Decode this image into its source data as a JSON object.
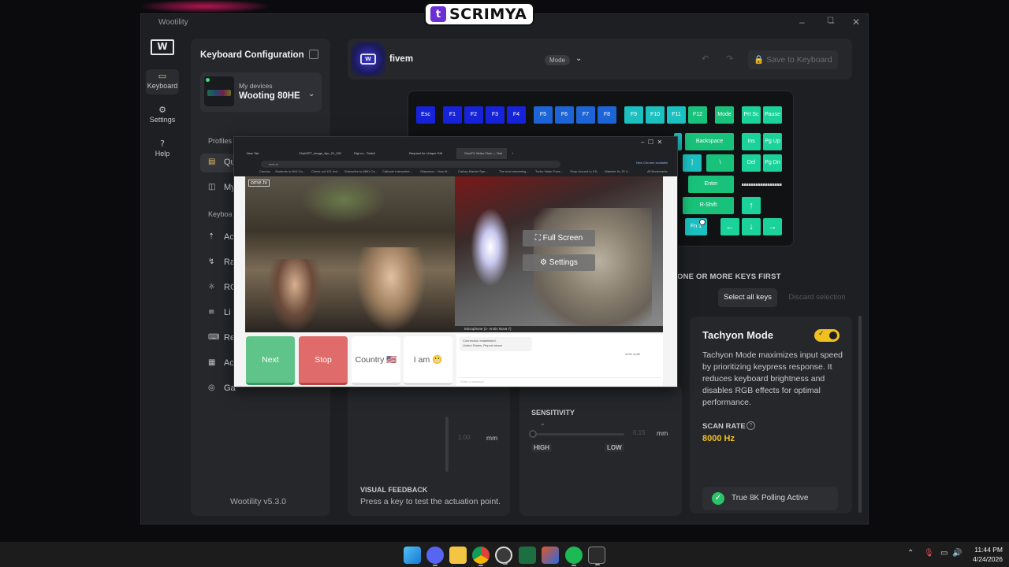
{
  "overlay_brand": {
    "logo": "t",
    "name": "SCRIMYA"
  },
  "window": {
    "title": "Wootility",
    "controls": {
      "minimize": "–",
      "maximize": "☐",
      "close": "✕"
    }
  },
  "rail": {
    "logo": "W",
    "items": [
      {
        "label": "Keyboard",
        "icon": "keyboard-icon",
        "glyph": "▭",
        "active": true
      },
      {
        "label": "Settings",
        "icon": "gear-icon",
        "glyph": "⚙",
        "active": false
      },
      {
        "label": "Help",
        "icon": "help-icon",
        "glyph": "?",
        "active": false
      }
    ]
  },
  "config": {
    "title": "Keyboard Configuration",
    "device_sub": "My devices",
    "device_name": "Wooting 80HE",
    "profiles_label": "Profiles",
    "profile_rows": [
      {
        "label": "Qu",
        "icon": "quick-profile-icon",
        "glyph": "▤",
        "active": true
      },
      {
        "label": "My",
        "icon": "my-profiles-icon",
        "glyph": "◫",
        "active": false
      }
    ],
    "keyboard_label": "Keyboa",
    "keyboard_rows": [
      {
        "label": "Ac",
        "icon": "actuation-icon",
        "glyph": "⇡"
      },
      {
        "label": "Ra",
        "icon": "rapid-trigger-icon",
        "glyph": "↯"
      },
      {
        "label": "RG",
        "icon": "rgb-icon",
        "glyph": "☼"
      },
      {
        "label": "Li",
        "icon": "lighting-icon",
        "glyph": "≡"
      },
      {
        "label": "Re",
        "icon": "remap-icon",
        "glyph": "⌨"
      },
      {
        "label": "Ac",
        "icon": "advanced-keys-icon",
        "glyph": "▦"
      },
      {
        "label": "Ga",
        "icon": "gamepad-icon",
        "glyph": "◎"
      }
    ],
    "version": "Wootility v5.3.0"
  },
  "profile_bar": {
    "icon_text": "W",
    "name": "fivem",
    "mode_label": "Mode",
    "undo": "↶",
    "redo": "↷",
    "save_label": "Save to Keyboard"
  },
  "keyboard_keys": {
    "row1": [
      "Esc",
      "F1",
      "F2",
      "F3",
      "F4",
      "F5",
      "F6",
      "F7",
      "F8",
      "F9",
      "F10",
      "F11",
      "F12",
      "Mode",
      "Prt Sc",
      "Pause"
    ],
    "row2": [
      "Backspace",
      "Ins",
      "Pg Up"
    ],
    "row3": [
      "]",
      "\\",
      "Del",
      "Pg Dn"
    ],
    "row4": [
      "Enter"
    ],
    "row5": [
      "R-Shift",
      "↑"
    ],
    "row6": [
      "Fn 1",
      "←",
      "↓",
      "→"
    ]
  },
  "selection": {
    "hint": "ONE OR MORE KEYS FIRST",
    "select_all": "Select all keys",
    "discard": "Discard selection"
  },
  "actuation": {
    "value": "1.00",
    "unit": "mm",
    "feedback_title": "VISUAL FEEDBACK",
    "feedback_text": "Press a key to test the actuation point."
  },
  "sensitivity": {
    "title": "SENSITIVITY",
    "value": "0.15",
    "unit": "mm",
    "high": "HIGH",
    "low": "LOW"
  },
  "tachyon": {
    "title": "Tachyon Mode",
    "enabled": true,
    "description": "Tachyon Mode maximizes input speed by prioritizing keypress response. It reduces keyboard brightness and disables RGB effects for optimal performance.",
    "scan_rate_label": "SCAN RATE",
    "scan_rate_value": "8000 Hz",
    "polling_status": "True 8K Polling Active"
  },
  "browser": {
    "tabs": [
      "New Tab",
      "ChatGPT_Image_Apr_21_2026",
      "Digi no - Twitch",
      "Request for Unique Gift",
      "OmeTV Video Chat — Omi",
      "Tab"
    ],
    "address": "ome.tv",
    "update_notice": "New Chrome available",
    "bookmarks": [
      "Canvas",
      "Students in MUI Ca...",
      "Check out 101 Insi...",
      "Subscribe to 8861 Ca...",
      "Cathode Interactive...",
      "Glassdoor - How M...",
      "Cathey Market Spe...",
      "The best streaming...",
      "Turbo Vader Fans...",
      "Shop Around to it 5...",
      "Watcher fix JS 4...",
      "All Bookmarks"
    ],
    "video_logo": "ome.tv",
    "full_screen": "Full Screen",
    "settings": "Settings",
    "mic_label": "Microphone (1- Arctis Nova 7)",
    "buttons": {
      "next": "Next",
      "stop": "Stop",
      "country": "Country 🇺🇸",
      "iam": "I am 😬"
    },
    "chat_line1": "Connection established.",
    "chat_line2": "United States, Report abuse",
    "chat_input": "Write a message",
    "chat_bubble": "ub9b ub88"
  },
  "taskbar": {
    "time": "11:44 PM",
    "date": "4/24/2026",
    "apps": [
      "windows-start",
      "discord",
      "file-explorer",
      "chrome",
      "obs-studio",
      "excel",
      "office",
      "spotify",
      "wootility"
    ]
  },
  "colors": {
    "accent_gold": "#f0c020",
    "key_blue": "#1723d8",
    "key_teal": "#1cc0c0",
    "key_green": "#19c27a",
    "next_green": "#5fc48a",
    "stop_red": "#e06b6b"
  }
}
